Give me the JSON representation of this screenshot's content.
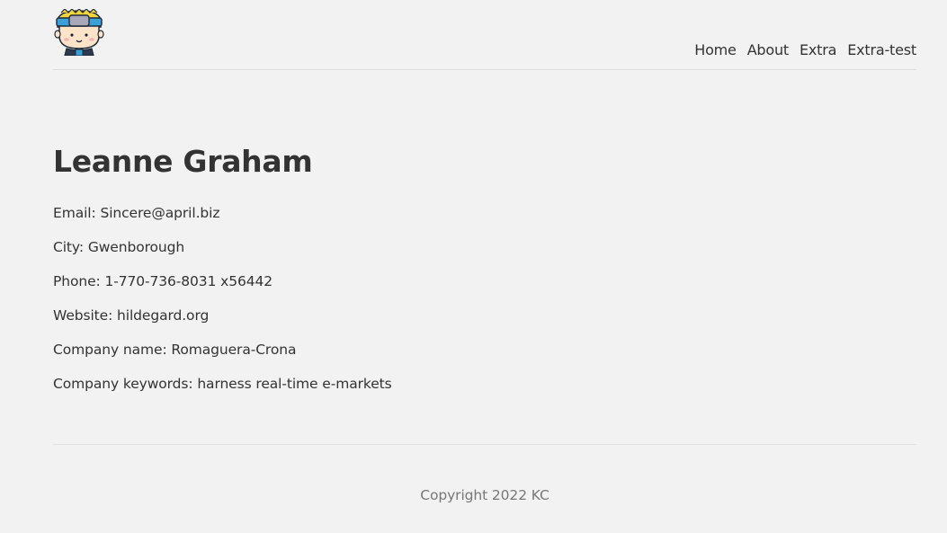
{
  "nav": {
    "items": [
      "Home",
      "About",
      "Extra",
      "Extra-test"
    ]
  },
  "logo": {
    "icon": "cartoon-boy-with-headband-icon",
    "colors": {
      "hair": "#f3d43b",
      "band": "#3aa0d8",
      "skin": "#fde3c8",
      "outline": "#1f2a3a"
    }
  },
  "profile": {
    "name": "Leanne Graham",
    "fields": [
      {
        "label": "Email",
        "value": "Sincere@april.biz"
      },
      {
        "label": "City",
        "value": "Gwenborough"
      },
      {
        "label": "Phone",
        "value": "1-770-736-8031 x56442"
      },
      {
        "label": "Website",
        "value": "hildegard.org"
      },
      {
        "label": "Company name",
        "value": "Romaguera-Crona"
      },
      {
        "label": "Company keywords",
        "value": "harness real-time e-markets"
      }
    ]
  },
  "footer": {
    "copyright": "Copyright 2022 KC"
  }
}
